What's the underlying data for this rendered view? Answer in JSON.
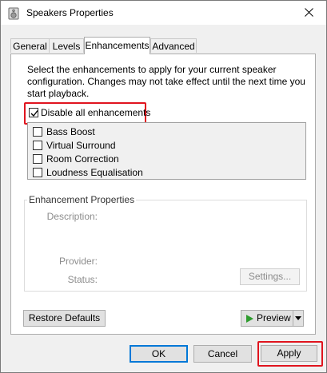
{
  "window": {
    "title": "Speakers Properties",
    "close_icon": "close-icon"
  },
  "tabs": [
    {
      "label": "General",
      "active": false
    },
    {
      "label": "Levels",
      "active": false
    },
    {
      "label": "Enhancements",
      "active": true
    },
    {
      "label": "Advanced",
      "active": false
    }
  ],
  "enhancements": {
    "intro_text": "Select the enhancements to apply for your current speaker configuration. Changes may not take effect until the next time you start playback.",
    "disable_all": {
      "label": "Disable all enhancements",
      "checked": true
    },
    "items": [
      {
        "label": "Bass Boost",
        "checked": false
      },
      {
        "label": "Virtual Surround",
        "checked": false
      },
      {
        "label": "Room Correction",
        "checked": false
      },
      {
        "label": "Loudness Equalisation",
        "checked": false
      }
    ]
  },
  "properties": {
    "title": "Enhancement Properties",
    "description_label": "Description:",
    "provider_label": "Provider:",
    "status_label": "Status:",
    "settings_button": "Settings..."
  },
  "actions": {
    "restore_defaults": "Restore Defaults",
    "preview": "Preview",
    "ok": "OK",
    "cancel": "Cancel",
    "apply": "Apply"
  },
  "colors": {
    "highlight": "#e0141e",
    "preview_play": "#2e9c2e",
    "focus": "#0078d7"
  }
}
